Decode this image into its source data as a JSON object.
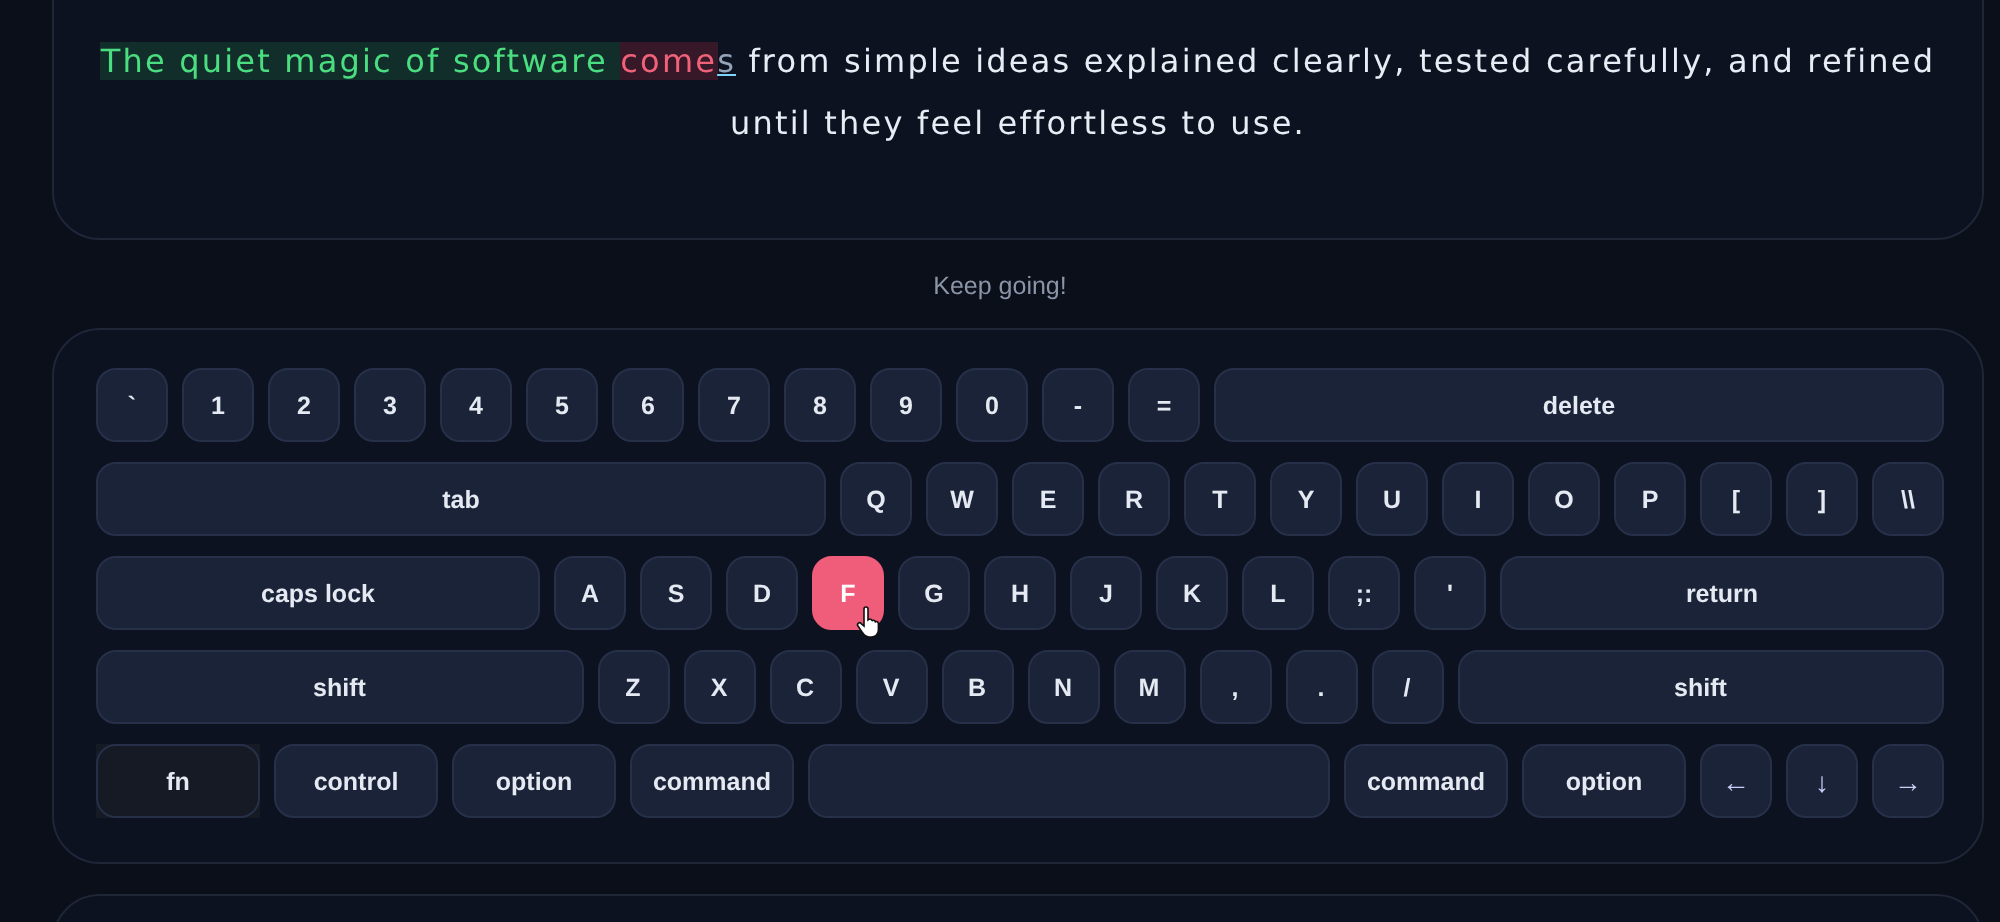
{
  "passage": {
    "segments": [
      {
        "text": "The quiet magic of software ",
        "typed": true,
        "error": false,
        "current": false
      },
      {
        "text": "come",
        "typed": true,
        "error": true,
        "current": false
      },
      {
        "text": "s",
        "typed": false,
        "error": false,
        "current": true
      },
      {
        "text": " from simple ideas explained clearly, tested carefully, and refined until they feel effortless to use.",
        "typed": false,
        "error": false,
        "current": false
      }
    ]
  },
  "status": "Keep going!",
  "keyboard": {
    "rows": [
      {
        "keys": [
          {
            "label": "`",
            "kind": "char"
          },
          {
            "label": "1",
            "kind": "char"
          },
          {
            "label": "2",
            "kind": "char"
          },
          {
            "label": "3",
            "kind": "char"
          },
          {
            "label": "4",
            "kind": "char"
          },
          {
            "label": "5",
            "kind": "char"
          },
          {
            "label": "6",
            "kind": "char"
          },
          {
            "label": "7",
            "kind": "char"
          },
          {
            "label": "8",
            "kind": "char"
          },
          {
            "label": "9",
            "kind": "char"
          },
          {
            "label": "0",
            "kind": "char"
          },
          {
            "label": "-",
            "kind": "char"
          },
          {
            "label": "=",
            "kind": "char"
          },
          {
            "label": "delete",
            "kind": "wide"
          }
        ]
      },
      {
        "keys": [
          {
            "label": "tab",
            "kind": "wide"
          },
          {
            "label": "Q",
            "kind": "char"
          },
          {
            "label": "W",
            "kind": "char"
          },
          {
            "label": "E",
            "kind": "char"
          },
          {
            "label": "R",
            "kind": "char"
          },
          {
            "label": "T",
            "kind": "char"
          },
          {
            "label": "Y",
            "kind": "char"
          },
          {
            "label": "U",
            "kind": "char"
          },
          {
            "label": "I",
            "kind": "char"
          },
          {
            "label": "O",
            "kind": "char"
          },
          {
            "label": "P",
            "kind": "char"
          },
          {
            "label": "[",
            "kind": "char"
          },
          {
            "label": "]",
            "kind": "char"
          },
          {
            "label": "\\\\",
            "kind": "char"
          }
        ]
      },
      {
        "keys": [
          {
            "label": "caps lock",
            "kind": "wide"
          },
          {
            "label": "A",
            "kind": "char"
          },
          {
            "label": "S",
            "kind": "char"
          },
          {
            "label": "D",
            "kind": "char"
          },
          {
            "label": "F",
            "kind": "char",
            "selected": true
          },
          {
            "label": "G",
            "kind": "char"
          },
          {
            "label": "H",
            "kind": "char"
          },
          {
            "label": "J",
            "kind": "char"
          },
          {
            "label": "K",
            "kind": "char"
          },
          {
            "label": "L",
            "kind": "char"
          },
          {
            "label": ";:",
            "kind": "char"
          },
          {
            "label": "'",
            "kind": "char"
          },
          {
            "label": "return",
            "kind": "wide"
          }
        ]
      },
      {
        "keys": [
          {
            "label": "shift",
            "kind": "wide"
          },
          {
            "label": "Z",
            "kind": "char"
          },
          {
            "label": "X",
            "kind": "char"
          },
          {
            "label": "C",
            "kind": "char"
          },
          {
            "label": "V",
            "kind": "char"
          },
          {
            "label": "B",
            "kind": "char"
          },
          {
            "label": "N",
            "kind": "char"
          },
          {
            "label": "M",
            "kind": "char"
          },
          {
            "label": ",",
            "kind": "char"
          },
          {
            "label": ".",
            "kind": "char"
          },
          {
            "label": "/",
            "kind": "char"
          },
          {
            "label": "shift",
            "kind": "wide"
          }
        ]
      },
      {
        "keys": [
          {
            "label": "fn",
            "kind": "fn"
          },
          {
            "label": "control",
            "kind": "mod"
          },
          {
            "label": "option",
            "kind": "mod"
          },
          {
            "label": "command",
            "kind": "mod"
          },
          {
            "kind": "space"
          },
          {
            "label": "command",
            "kind": "mod"
          },
          {
            "label": "option",
            "kind": "mod"
          },
          {
            "label": "←",
            "kind": "arrow"
          },
          {
            "label": "↓",
            "kind": "arrow"
          },
          {
            "label": "→",
            "kind": "arrow"
          }
        ]
      }
    ]
  }
}
